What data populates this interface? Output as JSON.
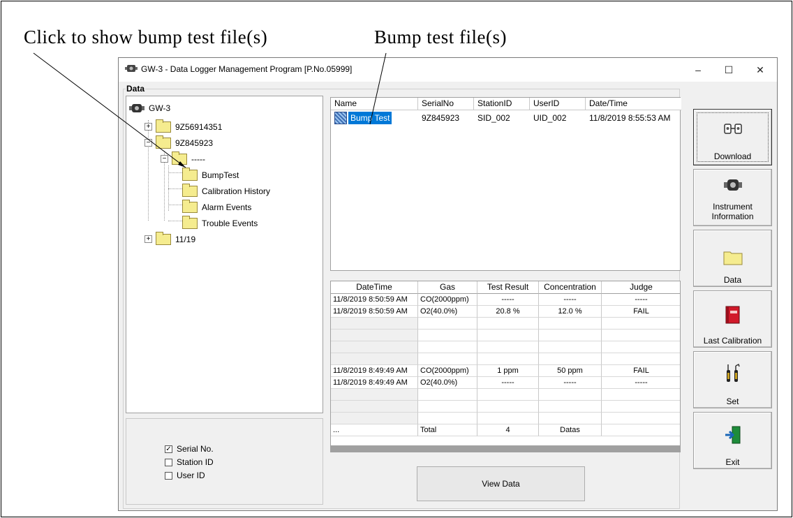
{
  "callouts": {
    "show_bump": "Click to show bump test file(s)",
    "bump_files": "Bump test file(s)"
  },
  "window": {
    "title": "GW-3 - Data Logger Management Program [P.No.05999]",
    "controls": {
      "minimize": "–",
      "maximize": "☐",
      "close": "✕"
    }
  },
  "data_group": {
    "label": "Data"
  },
  "tree": {
    "root": "GW-3",
    "nodes": [
      "9Z56914351",
      "9Z845923",
      "-----",
      "BumpTest",
      "Calibration History",
      "Alarm Events",
      "Trouble Events",
      "11/19"
    ],
    "expanders": {
      "collapsed": "+",
      "expanded": "−"
    }
  },
  "options": {
    "serial": {
      "label": "Serial No.",
      "checked": "✓"
    },
    "station": {
      "label": "Station ID"
    },
    "user": {
      "label": "User ID"
    }
  },
  "file_list": {
    "columns": [
      "Name",
      "SerialNo",
      "StationID",
      "UserID",
      "Date/Time"
    ],
    "row": {
      "name": "Bump Test",
      "serial": "9Z845923",
      "station": "SID_002",
      "user": "UID_002",
      "datetime": "11/8/2019 8:55:53 AM"
    }
  },
  "grid": {
    "columns": [
      "DateTime",
      "Gas",
      "Test Result",
      "Concentration",
      "Judge"
    ],
    "rows": [
      [
        "11/8/2019 8:50:59 AM",
        "CO(2000ppm)",
        "-----",
        "-----",
        "-----"
      ],
      [
        "11/8/2019 8:50:59 AM",
        "O2(40.0%)",
        "20.8 %",
        "12.0 %",
        "FAIL"
      ],
      [
        "",
        "",
        "",
        "",
        ""
      ],
      [
        "",
        "",
        "",
        "",
        ""
      ],
      [
        "",
        "",
        "",
        "",
        ""
      ],
      [
        "",
        "",
        "",
        "",
        ""
      ],
      [
        "11/8/2019 8:49:49 AM",
        "CO(2000ppm)",
        "1 ppm",
        "50 ppm",
        "FAIL"
      ],
      [
        "11/8/2019 8:49:49 AM",
        "O2(40.0%)",
        "-----",
        "-----",
        "-----"
      ],
      [
        "",
        "",
        "",
        "",
        ""
      ],
      [
        "",
        "",
        "",
        "",
        ""
      ],
      [
        "",
        "",
        "",
        "",
        ""
      ],
      [
        "...",
        "Total",
        "4",
        "Datas",
        ""
      ]
    ]
  },
  "view_data_label": "View Data",
  "side_buttons": {
    "download": "Download",
    "instrument_1": "Instrument",
    "instrument_2": "Information",
    "data": "Data",
    "last_cal": "Last Calibration",
    "set": "Set",
    "exit": "Exit"
  },
  "colors": {
    "selection": "#0078d7",
    "folder": "#f5ec8f",
    "window_bg": "#f0f0f0"
  }
}
